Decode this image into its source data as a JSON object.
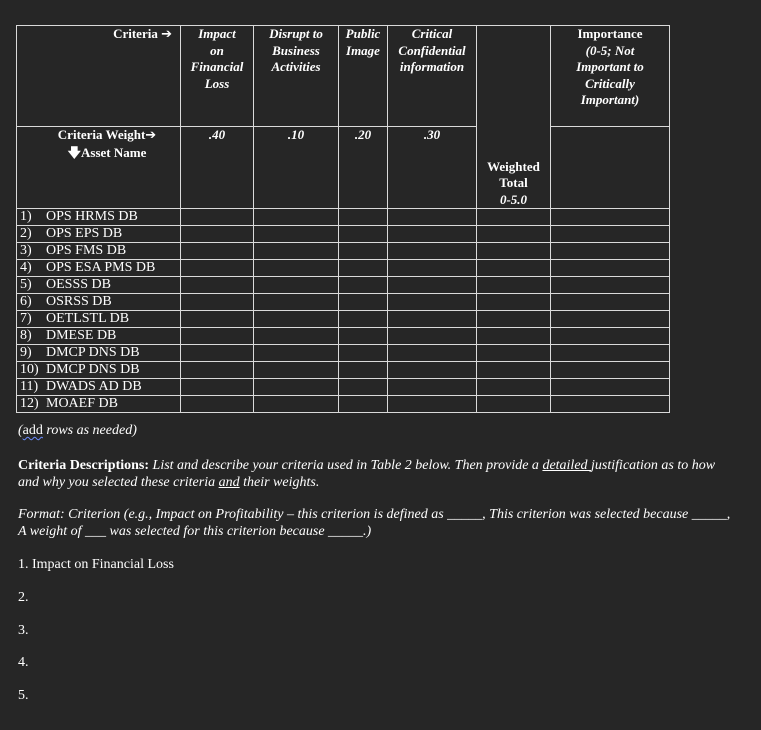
{
  "table": {
    "criteria_label": "Criteria",
    "criteria_weight_label": "Criteria Weight",
    "asset_name_label": "Asset Name",
    "columns": [
      {
        "header": [
          "Impact",
          "on",
          "Financial",
          "Loss"
        ],
        "weight": ".40"
      },
      {
        "header": [
          "Disrupt to",
          "Business",
          "Activities"
        ],
        "weight": ".10"
      },
      {
        "header": [
          "Public",
          "Image"
        ],
        "weight": ".20"
      },
      {
        "header": [
          "Critical",
          "Confidential",
          "information"
        ],
        "weight": ".30"
      }
    ],
    "weighted_total": {
      "lines": [
        "Weighted",
        "Total"
      ],
      "range": "0-5.0"
    },
    "importance": {
      "lines": [
        "Importance",
        "(0-5; Not",
        "Important to",
        "Critically",
        "Important)"
      ]
    },
    "rows": [
      {
        "num": "1)",
        "asset": "OPS HRMS DB"
      },
      {
        "num": "2)",
        "asset": "OPS EPS DB"
      },
      {
        "num": "3)",
        "asset": "OPS FMS DB"
      },
      {
        "num": "4)",
        "asset": "OPS ESA PMS DB"
      },
      {
        "num": "5)",
        "asset": "OESSS DB"
      },
      {
        "num": "6)",
        "asset": "OSRSS DB"
      },
      {
        "num": "7)",
        "asset": "OETLSTL DB"
      },
      {
        "num": "8)",
        "asset": "DMESE DB"
      },
      {
        "num": "9)",
        "asset": "DMCP DNS DB"
      },
      {
        "num": "10)",
        "asset": "DMCP DNS DB"
      },
      {
        "num": "11)",
        "asset": "DWADS AD DB"
      },
      {
        "num": "12)",
        "asset": "MOAEF DB"
      }
    ]
  },
  "note": {
    "prefix": "(",
    "add": "add",
    "rest": " rows as needed)"
  },
  "criteria_descriptions": {
    "label": "Criteria Descriptions:",
    "text1": " List and describe your criteria used in Table 2 below. Then provide a ",
    "detailed": "detailed ",
    "text2": "justification as to how and why you selected these criteria ",
    "and": "and",
    "text3": " their weights."
  },
  "format": {
    "text1": "Format: Criterion (e.g., Impact on Profitability – this criterion is defined as _____, This criterion was selected because _____, A weight of ___ was selected for this criterion because _____.)"
  },
  "list": [
    "1. Impact on Financial Loss",
    "2.",
    "3.",
    "4.",
    "5."
  ]
}
